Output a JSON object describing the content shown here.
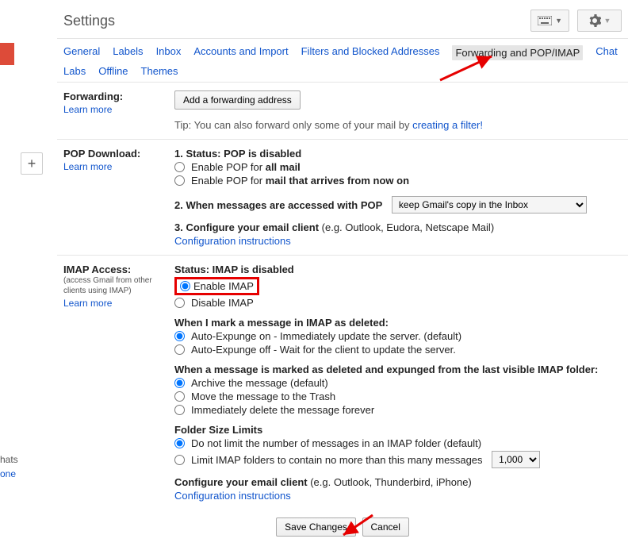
{
  "header": {
    "title": "Settings"
  },
  "leftrail": {
    "hats": "hats",
    "one": "one",
    "plus": "+"
  },
  "tabs": {
    "general": "General",
    "labels": "Labels",
    "inbox": "Inbox",
    "accounts": "Accounts and Import",
    "filters": "Filters and Blocked Addresses",
    "forwarding": "Forwarding and POP/IMAP",
    "chat": "Chat",
    "labs": "Labs",
    "offline": "Offline",
    "themes": "Themes"
  },
  "forwarding": {
    "title": "Forwarding:",
    "learn": "Learn more",
    "addBtn": "Add a forwarding address",
    "tipPrefix": "Tip: You can also forward only some of your mail by ",
    "tipLink": "creating a filter!"
  },
  "pop": {
    "title": "POP Download:",
    "learn": "Learn more",
    "statusLabel": "1. Status: ",
    "statusValue": "POP is disabled",
    "enableAllPrefix": "Enable POP for ",
    "enableAllBold": "all mail",
    "enableNowPrefix": "Enable POP for ",
    "enableNowBold": "mail that arrives from now on",
    "whenAccessed": "2. When messages are accessed with POP",
    "dropdown": "keep Gmail's copy in the Inbox",
    "configureHead": "3. Configure your email client ",
    "configureTail": "(e.g. Outlook, Eudora, Netscape Mail)",
    "configLink": "Configuration instructions"
  },
  "imap": {
    "title": "IMAP Access:",
    "sub": "(access Gmail from other clients using IMAP)",
    "learn": "Learn more",
    "statusLabel": "Status: ",
    "statusValue": "IMAP is disabled",
    "enable": "Enable IMAP",
    "disable": "Disable IMAP",
    "deleteHead": "When I mark a message in IMAP as deleted:",
    "expungeOn": "Auto-Expunge on - Immediately update the server. (default)",
    "expungeOff": "Auto-Expunge off - Wait for the client to update the server.",
    "expungedHead": "When a message is marked as deleted and expunged from the last visible IMAP folder:",
    "archive": "Archive the message (default)",
    "trash": "Move the message to the Trash",
    "deleteForever": "Immediately delete the message forever",
    "folderHead": "Folder Size Limits",
    "noLimit": "Do not limit the number of messages in an IMAP folder (default)",
    "limitPrefix": "Limit IMAP folders to contain no more than this many messages",
    "limitValue": "1,000",
    "configureHead": "Configure your email client ",
    "configureTail": "(e.g. Outlook, Thunderbird, iPhone)",
    "configLink": "Configuration instructions"
  },
  "footer": {
    "save": "Save Changes",
    "cancel": "Cancel"
  }
}
